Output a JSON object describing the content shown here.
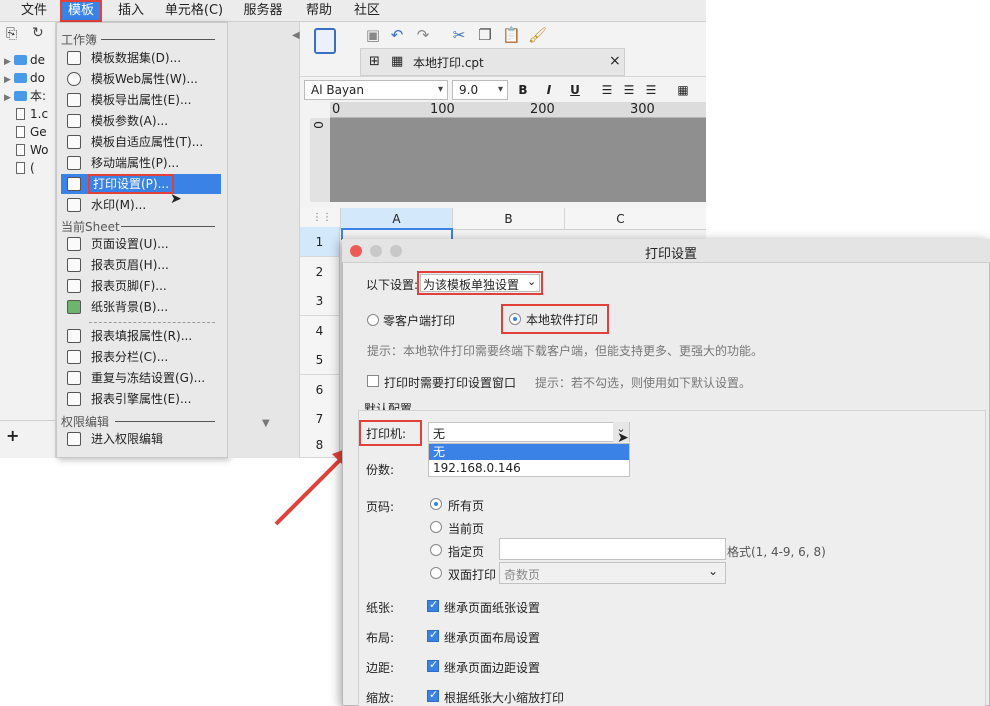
{
  "menubar": {
    "items": [
      "文件",
      "模板",
      "插入",
      "单元格(C)",
      "服务器",
      "帮助",
      "社区"
    ]
  },
  "tree": {
    "items": [
      {
        "label": "de",
        "kind": "folder"
      },
      {
        "label": "do",
        "kind": "folder"
      },
      {
        "label": "本:",
        "kind": "folder"
      },
      {
        "label": "1.c",
        "kind": "file"
      },
      {
        "label": "Ge",
        "kind": "file"
      },
      {
        "label": "Wo",
        "kind": "file"
      },
      {
        "label": "(",
        "kind": "file"
      }
    ]
  },
  "template_menu": {
    "section_workbook": "工作簿",
    "section_sheet": "当前Sheet",
    "section_permission": "权限编辑",
    "workbook_items": [
      "模板数据集(D)...",
      "模板Web属性(W)...",
      "模板导出属性(E)...",
      "模板参数(A)...",
      "模板自适应属性(T)...",
      "移动端属性(P)...",
      "打印设置(P)...",
      "水印(M)..."
    ],
    "sheet_items": [
      "页面设置(U)...",
      "报表页眉(H)...",
      "报表页脚(F)...",
      "纸张背景(B)..."
    ],
    "sheet_items_2": [
      "报表填报属性(R)...",
      "报表分栏(C)...",
      "重复与冻结设置(G)...",
      "报表引擎属性(E)..."
    ],
    "permission_items": [
      "进入权限编辑"
    ]
  },
  "editor": {
    "doc_tab": "本地打印.cpt",
    "font": "Al Bayan",
    "font_size": "9.0",
    "ruler_labels": [
      "0",
      "100",
      "200",
      "300"
    ],
    "vruler_label": "0",
    "columns": [
      "A",
      "B",
      "C"
    ],
    "rows": [
      "1",
      "2",
      "3",
      "4",
      "5",
      "6",
      "7",
      "8"
    ],
    "format_buttons": [
      "B",
      "I",
      "U"
    ]
  },
  "dialog": {
    "title": "打印设置",
    "setting_label": "以下设置:",
    "setting_value": "为该模板单独设置",
    "zero_client": "零客户端打印",
    "local_print": "本地软件打印",
    "hint_local": "提示：本地软件打印需要终端下载客户端，但能支持更多、更强大的功能。",
    "need_dialog": "打印时需要打印设置窗口",
    "hint_dialog": "提示：若不勾选，则使用如下默认设置。",
    "default_config": "默认配置",
    "printer_label": "打印机:",
    "printer_value": "无",
    "printer_options": [
      "无",
      "192.168.0.146"
    ],
    "copies_label": "份数:",
    "page_label": "页码:",
    "page_options": [
      "所有页",
      "当前页",
      "指定页",
      "双面打印"
    ],
    "page_format_hint": "格式(1, 4-9, 6, 8)",
    "duplex_value": "奇数页",
    "paper_label": "纸张:",
    "paper_value": "继承页面纸张设置",
    "layout_label": "布局:",
    "layout_value": "继承页面布局设置",
    "margin_label": "边距:",
    "margin_value": "继承页面边距设置",
    "scale_label": "缩放:",
    "scale_value": "根据纸张大小缩放打印"
  },
  "colors": {
    "accent": "#3b82e6",
    "highlight": "#e2403a"
  }
}
